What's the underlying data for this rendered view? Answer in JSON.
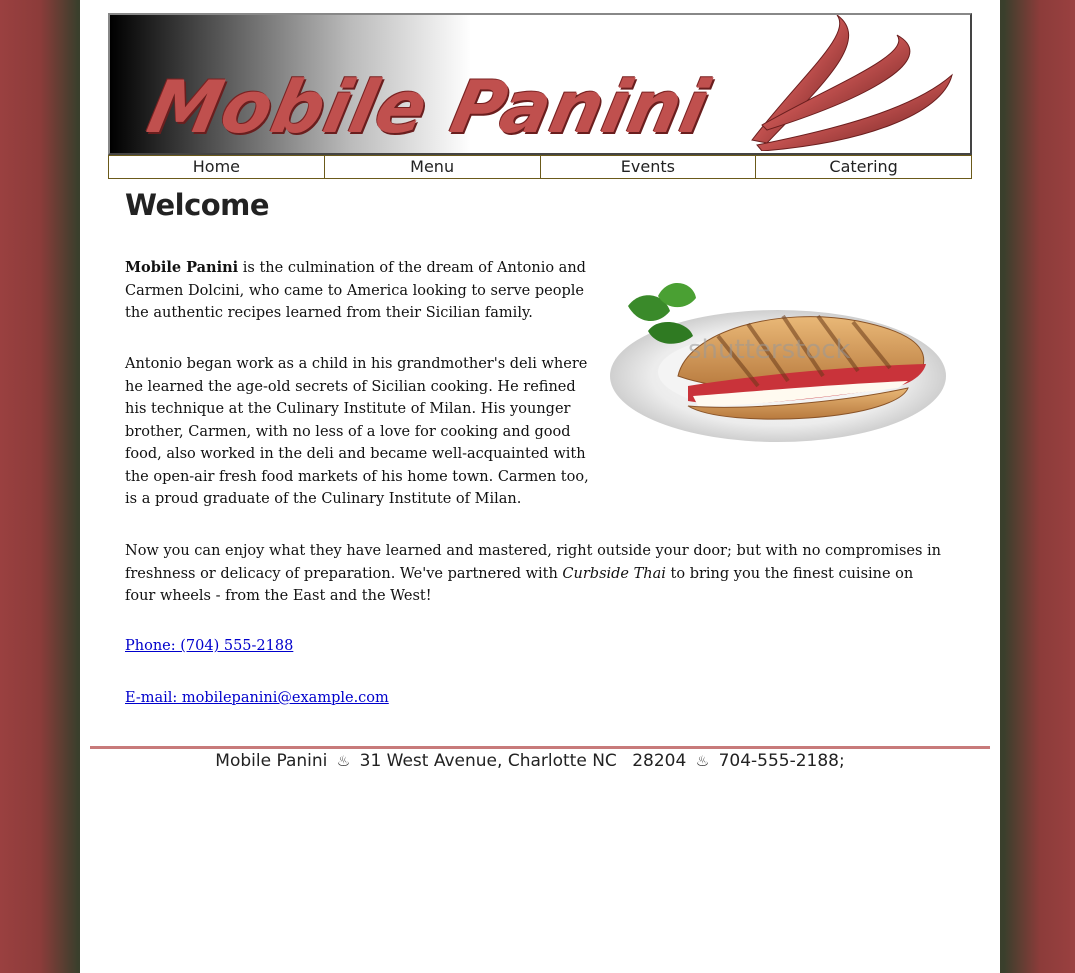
{
  "brand": {
    "title": "Mobile Panini"
  },
  "nav": {
    "items": [
      "Home",
      "Menu",
      "Events",
      "Catering"
    ]
  },
  "main": {
    "heading": "Welcome",
    "p1_strong": "Mobile Panini",
    "p1_rest": " is the culmination of the dream of Antonio and Carmen Dolcini, who came to America looking to serve people the authentic recipes learned from their Sicilian family.",
    "p2": "Antonio began work as a child in his grandmother's deli where he learned the age-old secrets of Sicilian cooking. He refined his technique at the Culinary Institute of Milan. His younger brother, Carmen, with no less of a love for cooking and good food, also worked in the deli and became well-acquainted with the open-air fresh food markets of his home town. Carmen too, is a proud graduate of the Culinary Institute of Milan.",
    "p3_a": "Now you can enjoy what they have learned and mastered, right outside your door; but with no compromises in freshness or delicacy of preparation. We've partnered with ",
    "p3_em": "Curbside Thai",
    "p3_b": " to bring you the finest cuisine on four wheels - from the East and the West!",
    "phone_link": "Phone: (704) 555-2188",
    "email_link": "E-mail: mobilepanini@example.com",
    "watermark": "shutterstock"
  },
  "footer": {
    "name": "Mobile Panini",
    "address": "31 West Avenue, Charlotte NC",
    "zip": "28204",
    "phone": "704-555-2188;",
    "icon": "hot-beverage-icon"
  },
  "colors": {
    "side_red": "#9a4040",
    "accent": "#c0504e",
    "rule": "#c87a7a",
    "nav_border": "#6b5a1a",
    "link": "#0000cc"
  }
}
